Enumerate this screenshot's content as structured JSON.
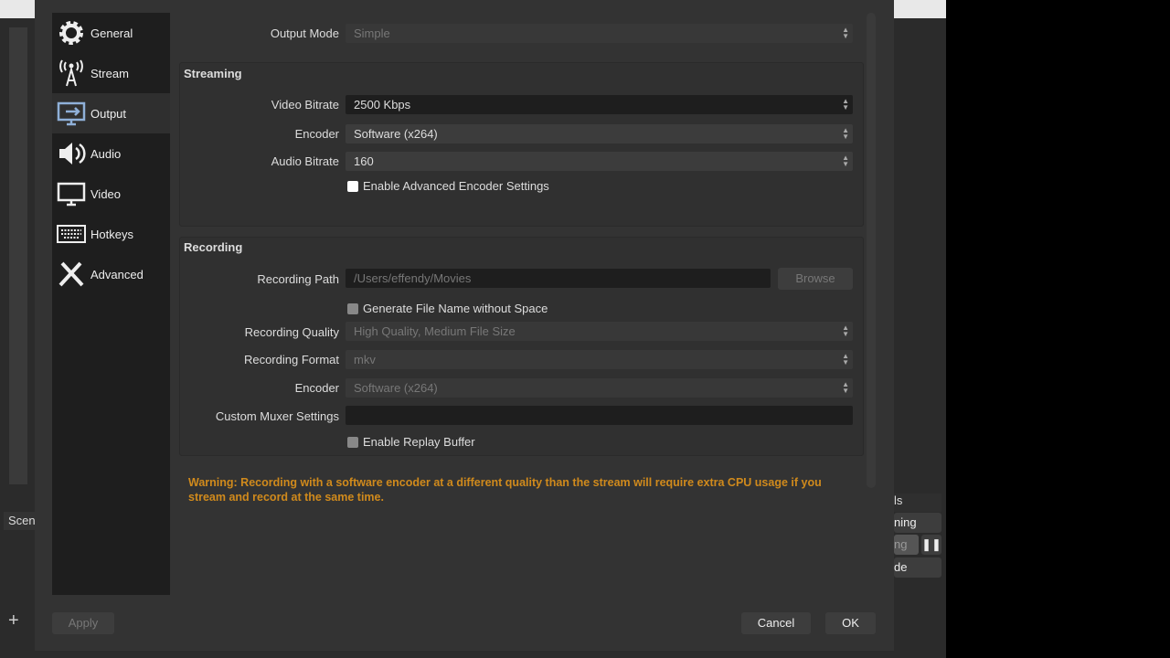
{
  "sidebar": {
    "items": [
      {
        "label": "General",
        "icon": "gear-icon"
      },
      {
        "label": "Stream",
        "icon": "antenna-icon"
      },
      {
        "label": "Output",
        "icon": "monitor-arrow-icon"
      },
      {
        "label": "Audio",
        "icon": "speaker-icon"
      },
      {
        "label": "Video",
        "icon": "monitor-icon"
      },
      {
        "label": "Hotkeys",
        "icon": "keyboard-icon"
      },
      {
        "label": "Advanced",
        "icon": "tools-icon"
      }
    ],
    "active": "Output"
  },
  "output_mode": {
    "label": "Output Mode",
    "value": "Simple"
  },
  "streaming": {
    "title": "Streaming",
    "video_bitrate_label": "Video Bitrate",
    "video_bitrate": "2500 Kbps",
    "encoder_label": "Encoder",
    "encoder": "Software (x264)",
    "audio_bitrate_label": "Audio Bitrate",
    "audio_bitrate": "160",
    "advanced_label": "Enable Advanced Encoder Settings"
  },
  "recording": {
    "title": "Recording",
    "path_label": "Recording Path",
    "path": "/Users/effendy/Movies",
    "browse": "Browse",
    "nospace_label": "Generate File Name without Space",
    "quality_label": "Recording Quality",
    "quality": "High Quality, Medium File Size",
    "format_label": "Recording Format",
    "format": "mkv",
    "encoder_label": "Encoder",
    "encoder": "Software (x264)",
    "muxer_label": "Custom Muxer Settings",
    "muxer": "",
    "replay_label": "Enable Replay Buffer"
  },
  "warning": "Warning: Recording with a software encoder at a different quality than the stream will require extra CPU usage if you stream and record at the same time.",
  "buttons": {
    "apply": "Apply",
    "cancel": "Cancel",
    "ok": "OK"
  },
  "background": {
    "scenes": "Scen",
    "controls": "ls",
    "streaming": "ning",
    "recording": "ng",
    "mode": "de"
  }
}
